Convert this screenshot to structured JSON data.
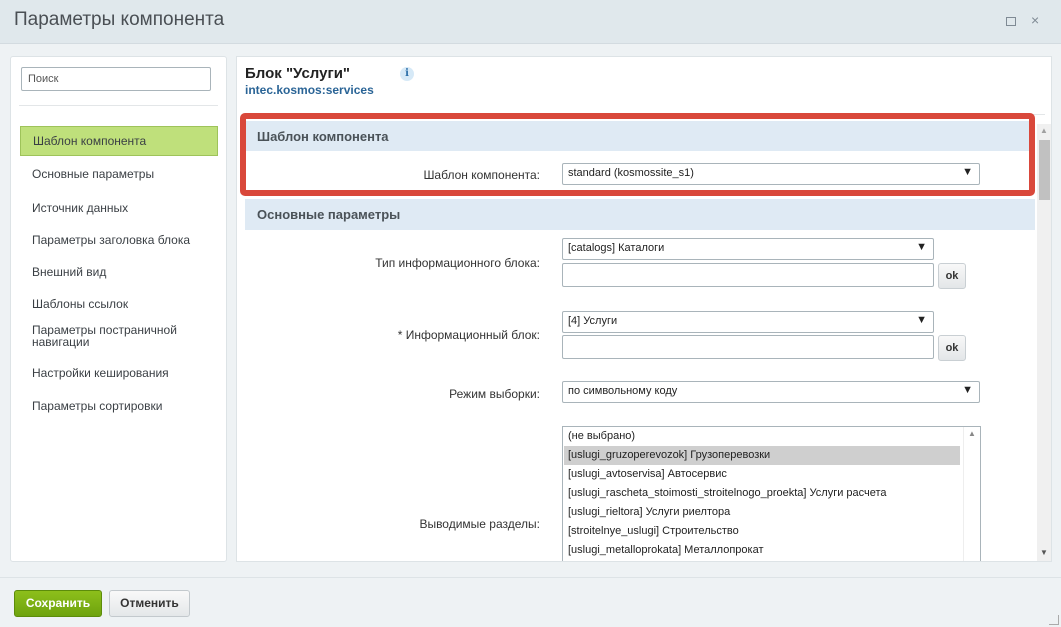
{
  "window": {
    "title": "Параметры компонента",
    "restore_icon": "restore-icon",
    "close_glyph": "×"
  },
  "sidebar": {
    "search_placeholder": "Поиск",
    "items": [
      {
        "label": "Шаблон компонента",
        "active": true
      },
      {
        "label": "Основные параметры"
      },
      {
        "label": "Источник данных"
      },
      {
        "label": "Параметры заголовка блока"
      },
      {
        "label": "Внешний вид"
      },
      {
        "label": "Шаблоны ссылок"
      },
      {
        "label": "Параметры постраничной навигации"
      },
      {
        "label": "Настройки кеширования"
      },
      {
        "label": "Параметры сортировки"
      }
    ]
  },
  "component": {
    "name": "Блок \"Услуги\"",
    "code": "intec.kosmos:services",
    "info_glyph": "i"
  },
  "sections": {
    "template": {
      "title": "Шаблон компонента",
      "field_label": "Шаблон компонента:",
      "field_value": "standard (kosmossite_s1)"
    },
    "main": {
      "title": "Основные параметры",
      "iblock_type_label": "Тип информационного блока:",
      "iblock_type_value": "[catalogs] Каталоги",
      "iblock_label": "* Информационный блок:",
      "iblock_value": "[4] Услуги",
      "ok_label": "ok",
      "mode_label": "Режим выборки:",
      "mode_value": "по символьному коду",
      "sections_label": "Выводимые разделы:",
      "sections_options": [
        "(не выбрано)",
        "[uslugi_gruzoperevozok] Грузоперевозки",
        "[uslugi_avtoservisa] Автосервис",
        "[uslugi_rascheta_stoimosti_stroitelnogo_proekta] Услуги расчета",
        "[uslugi_rieltora] Услуги риелтора",
        "[stroitelnye_uslugi] Строительство",
        "[uslugi_metalloprokata] Металлопрокат"
      ],
      "sections_selected_index": 1
    }
  },
  "footer": {
    "save_label": "Сохранить",
    "cancel_label": "Отменить"
  },
  "colors": {
    "active_item": "#bfe07b",
    "highlight": "#d9483b",
    "save_button": "#7cb011",
    "section_head": "#dfeaf4"
  }
}
